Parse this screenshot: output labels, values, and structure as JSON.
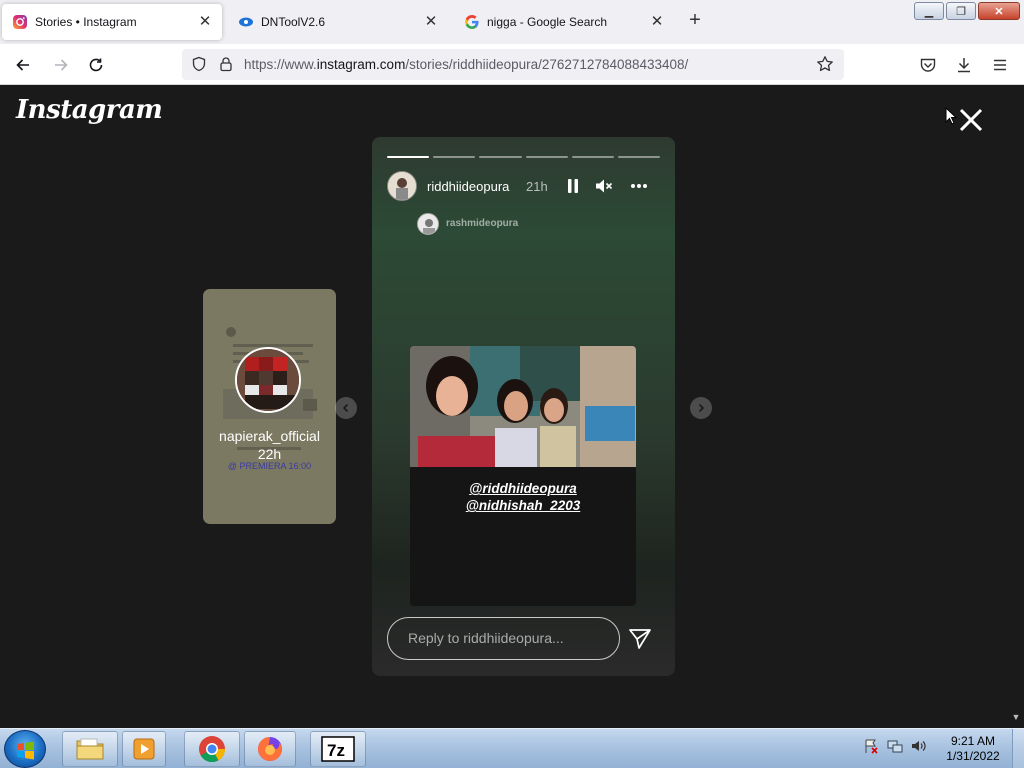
{
  "browser": {
    "tabs": [
      {
        "title": "Stories • Instagram",
        "active": true
      },
      {
        "title": "DNToolV2.6",
        "active": false
      },
      {
        "title": "nigga - Google Search",
        "active": false
      }
    ],
    "url_prefix": "https://www.",
    "url_host": "instagram.com",
    "url_path": "/stories/riddhiideopura/2762712784088433408/"
  },
  "instagram": {
    "logo": "Instagram",
    "prev_story": {
      "username": "napierak_official",
      "time": "22h",
      "caption": "@ PREMIERA 16:00"
    },
    "story": {
      "username": "riddhiideopura",
      "time": "21h",
      "segments_total": 6,
      "segments_done": 1,
      "mention_name": "rashmideopura",
      "tags": [
        "@riddhiideopura",
        "@nidhishah_2203"
      ],
      "reply_placeholder": "Reply to riddhiideopura..."
    }
  },
  "taskbar": {
    "apps": [
      "file-explorer",
      "media-player",
      "chrome",
      "firefox",
      "7zip"
    ],
    "time": "9:21 AM",
    "date": "1/31/2022"
  }
}
